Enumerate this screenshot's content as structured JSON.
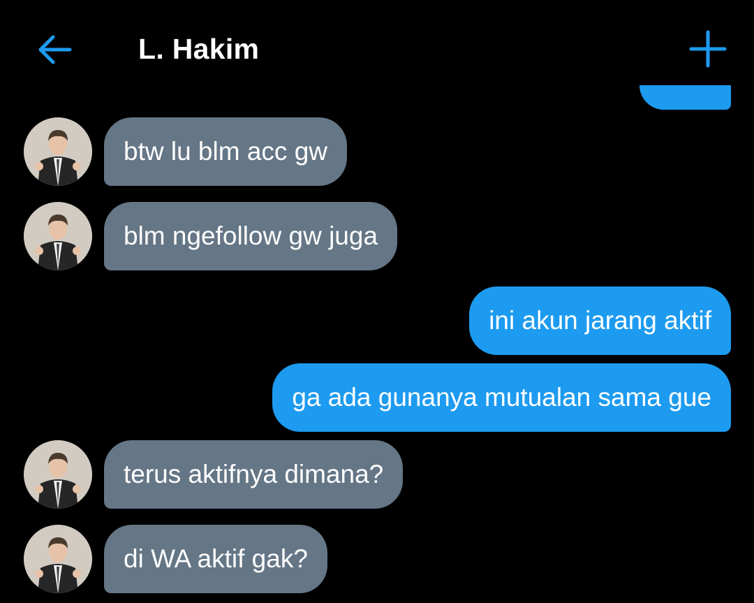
{
  "header": {
    "title": "L. Hakim",
    "back_icon": "arrow-left-icon",
    "action_icon": "plus-icon",
    "accent_color": "#1d9bf0"
  },
  "colors": {
    "background": "#000000",
    "incoming_bubble": "#657686",
    "outgoing_bubble": "#1d9bf0",
    "text": "#ffffff"
  },
  "messages": [
    {
      "direction": "incoming",
      "text": "btw lu blm acc gw"
    },
    {
      "direction": "incoming",
      "text": "blm ngefollow gw juga"
    },
    {
      "direction": "outgoing",
      "text": "ini akun jarang aktif"
    },
    {
      "direction": "outgoing",
      "text": "ga ada gunanya mutualan sama gue"
    },
    {
      "direction": "incoming",
      "text": "terus aktifnya dimana?"
    },
    {
      "direction": "incoming",
      "text": "di WA aktif gak?"
    }
  ]
}
